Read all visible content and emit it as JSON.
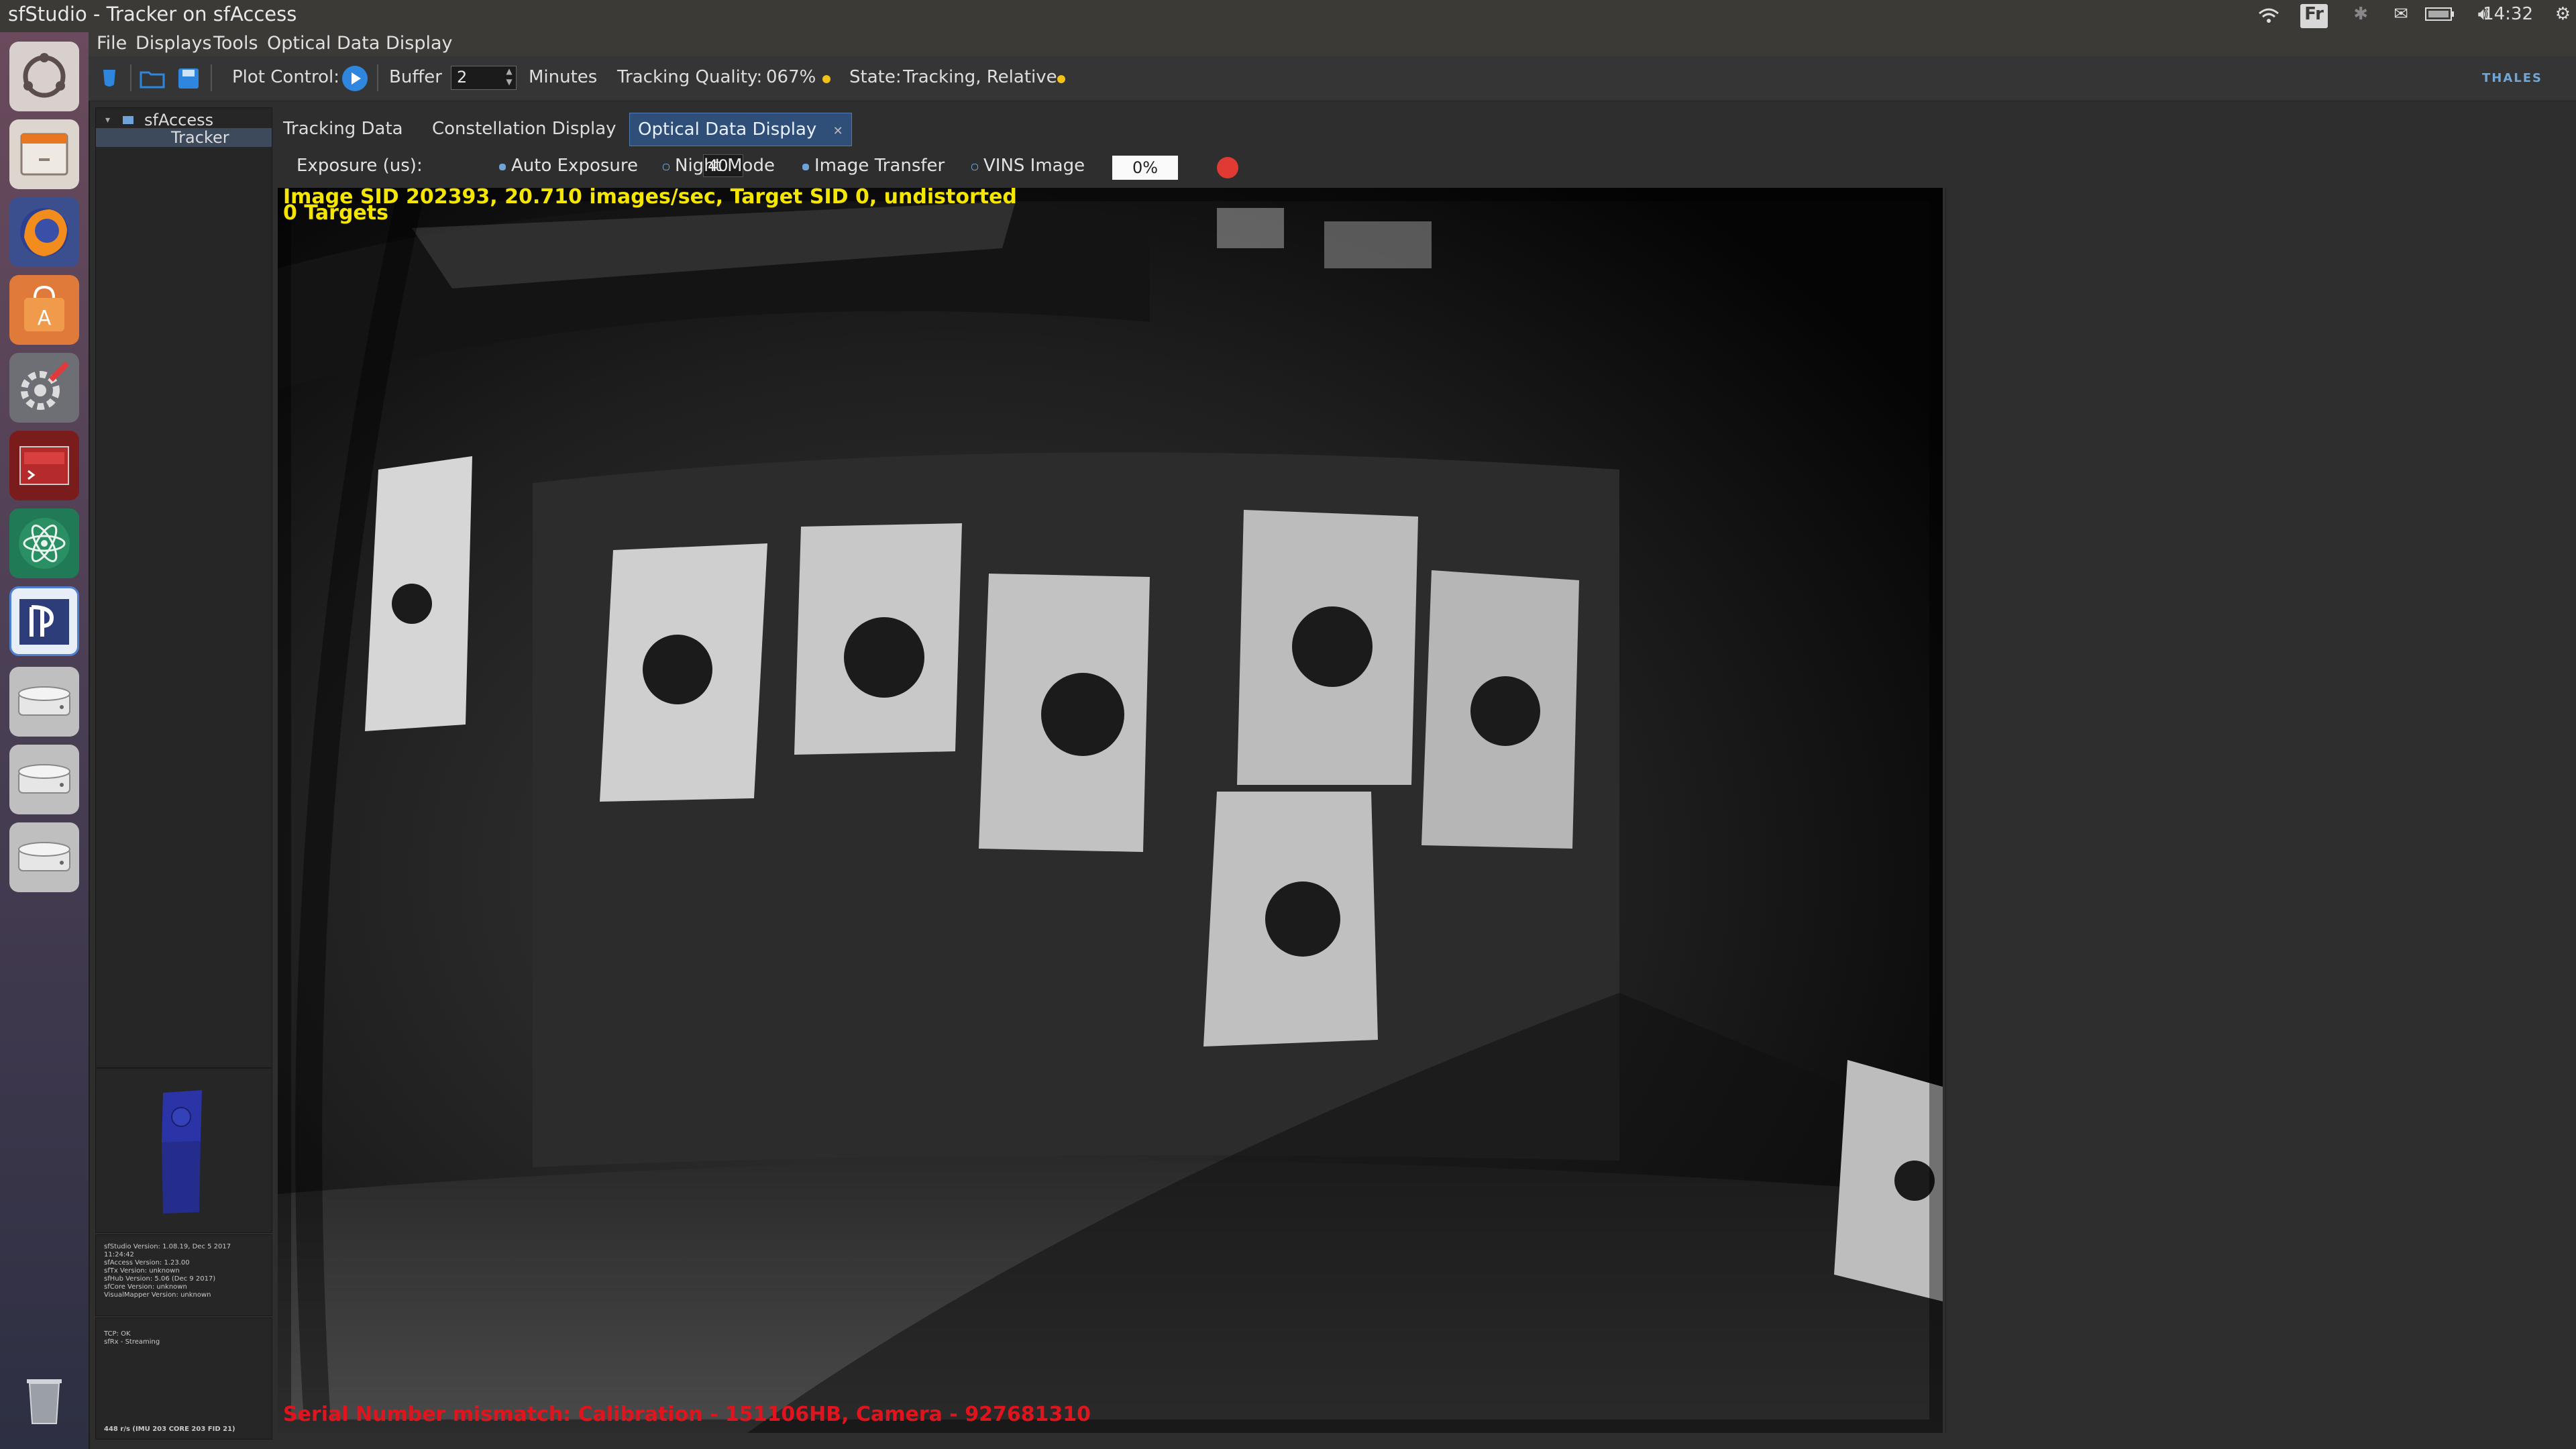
{
  "window": {
    "title": "sfStudio - Tracker on sfAccess"
  },
  "system_tray": {
    "keyboard_layout": "Fr",
    "clock": "14:32"
  },
  "menubar": {
    "items": [
      "File",
      "Displays",
      "Tools",
      "Optical Data Display"
    ]
  },
  "toolbar": {
    "plot_control_label": "Plot Control:",
    "buffer_label": "Buffer",
    "buffer_value": "2",
    "buffer_unit": "Minutes",
    "tracking_quality_label": "Tracking Quality:",
    "tracking_quality_value": "067%",
    "state_label": "State:",
    "state_value": "Tracking, Relative",
    "brand": "THALES",
    "status_color": "#f2c21b"
  },
  "tree": {
    "items": [
      {
        "label": "sfAccess",
        "selected": false
      },
      {
        "label": "Tracker",
        "selected": true
      }
    ]
  },
  "version_info": [
    "sfStudio Version: 1.08.19, Dec 5 2017",
    "11:24:42",
    "sfAccess Version: 1.23.00",
    "sfTx Version: unknown",
    "sfHub Version: 5.06 (Dec 9 2017)",
    "sfCore Version: unknown",
    "VisualMapper Version: unknown"
  ],
  "connection_status": {
    "lines": [
      "TCP: OK",
      "sfRx - Streaming"
    ],
    "footer": "448 r/s (IMU 203 CORE 203 FID 21)"
  },
  "tabs": [
    {
      "label": "Tracking Data",
      "active": false
    },
    {
      "label": "Constellation Display",
      "active": false
    },
    {
      "label": "Optical Data Display",
      "active": true
    }
  ],
  "optical_controls": {
    "exposure_label": "Exposure (us):",
    "exposure_value": "40",
    "auto_exposure": "Auto Exposure",
    "night_mode": "Night Mode",
    "image_transfer": "Image Transfer",
    "vins_image": "VINS Image",
    "progress": "0%",
    "record_color": "#e03a32"
  },
  "image_overlay": {
    "line1": "Image SID 202393, 20.710 images/sec, Target SID 0, undistorted",
    "line2": "0 Targets",
    "error": "Serial Number mismatch: Calibration - 151106HB, Camera - 927681310"
  }
}
